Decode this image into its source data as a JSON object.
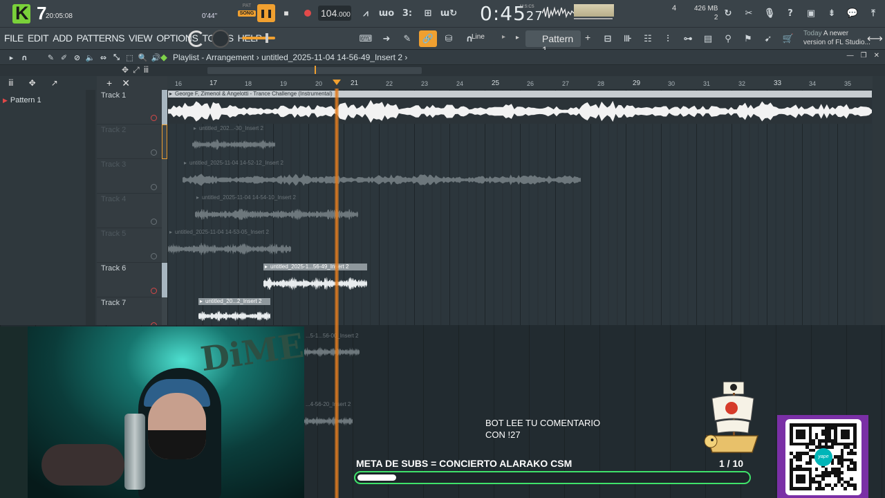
{
  "toolbar": {
    "app_number": "7",
    "clock_time": "20:05:08",
    "song_length": "0'44\"",
    "pat_label": "PAT",
    "song_label": "SONG",
    "tempo": "104",
    "tempo_decimal": ".000",
    "time_main": "0:45",
    "time_sub": "27",
    "time_units": "M:S:CS",
    "cpu_num": "4",
    "memory": "426 MB",
    "polyphony": "2"
  },
  "menu": {
    "items": [
      "FILE",
      "EDIT",
      "ADD",
      "PATTERNS",
      "VIEW",
      "OPTIONS",
      "TOOLS",
      "HELP"
    ],
    "snap_label": "Line",
    "pattern_selector": "Pattern 1",
    "news_title": "Today",
    "news_line1": "A newer",
    "news_line2": "version of FL Studio..."
  },
  "playlist": {
    "breadcrumb_root": "Playlist - Arrangement",
    "breadcrumb_file": "untitled_2025-11-04 14-56-49_Insert 2",
    "pattern_item": "Pattern 1",
    "tracks": [
      {
        "name": "Track 1"
      },
      {
        "name": "Track 2"
      },
      {
        "name": "Track 3"
      },
      {
        "name": "Track 4"
      },
      {
        "name": "Track 5"
      },
      {
        "name": "Track 6"
      },
      {
        "name": "Track 7"
      }
    ],
    "ruler": [
      "16",
      "17",
      "18",
      "19",
      "20",
      "21",
      "22",
      "23",
      "24",
      "25",
      "26",
      "27",
      "28",
      "29",
      "30",
      "31",
      "32",
      "33",
      "34",
      "35"
    ],
    "clips": [
      {
        "label": "George F, Zimenol & Angelotti - Trance Challenge (Instrumental)"
      },
      {
        "label": "untitled_202...-30_Insert 2"
      },
      {
        "label": "untitled_2025-11-04 14-52-12_Insert 2"
      },
      {
        "label": "untitled_2025-11-04 14-54-10_Insert 2"
      },
      {
        "label": "untitled_2025-11-04 14-53-05_Insert 2"
      },
      {
        "label": "untitled_2025-1...56-49_Insert 2"
      },
      {
        "label": "untitled_20...2_Insert 2"
      }
    ],
    "lower_clip_labels": [
      "...5-1...56-00_Insert 2",
      "...4-56-20_Insert 2"
    ]
  },
  "overlay": {
    "bot_line1": "BOT LEE TU COMENTARIO",
    "bot_line2": "CON !27",
    "goal_label": "META DE SUBS = CONCIERTO ALARAKO CSM",
    "goal_count": "1  / 10",
    "goal_progress": 0.1,
    "qr_brand": "yape",
    "qr_frame_color": "#7a2fa6",
    "bar_color": "#3fe26a"
  },
  "colors": {
    "accent": "#f0a030",
    "play_green": "#7fd34a",
    "record_red": "#e24a4a"
  }
}
